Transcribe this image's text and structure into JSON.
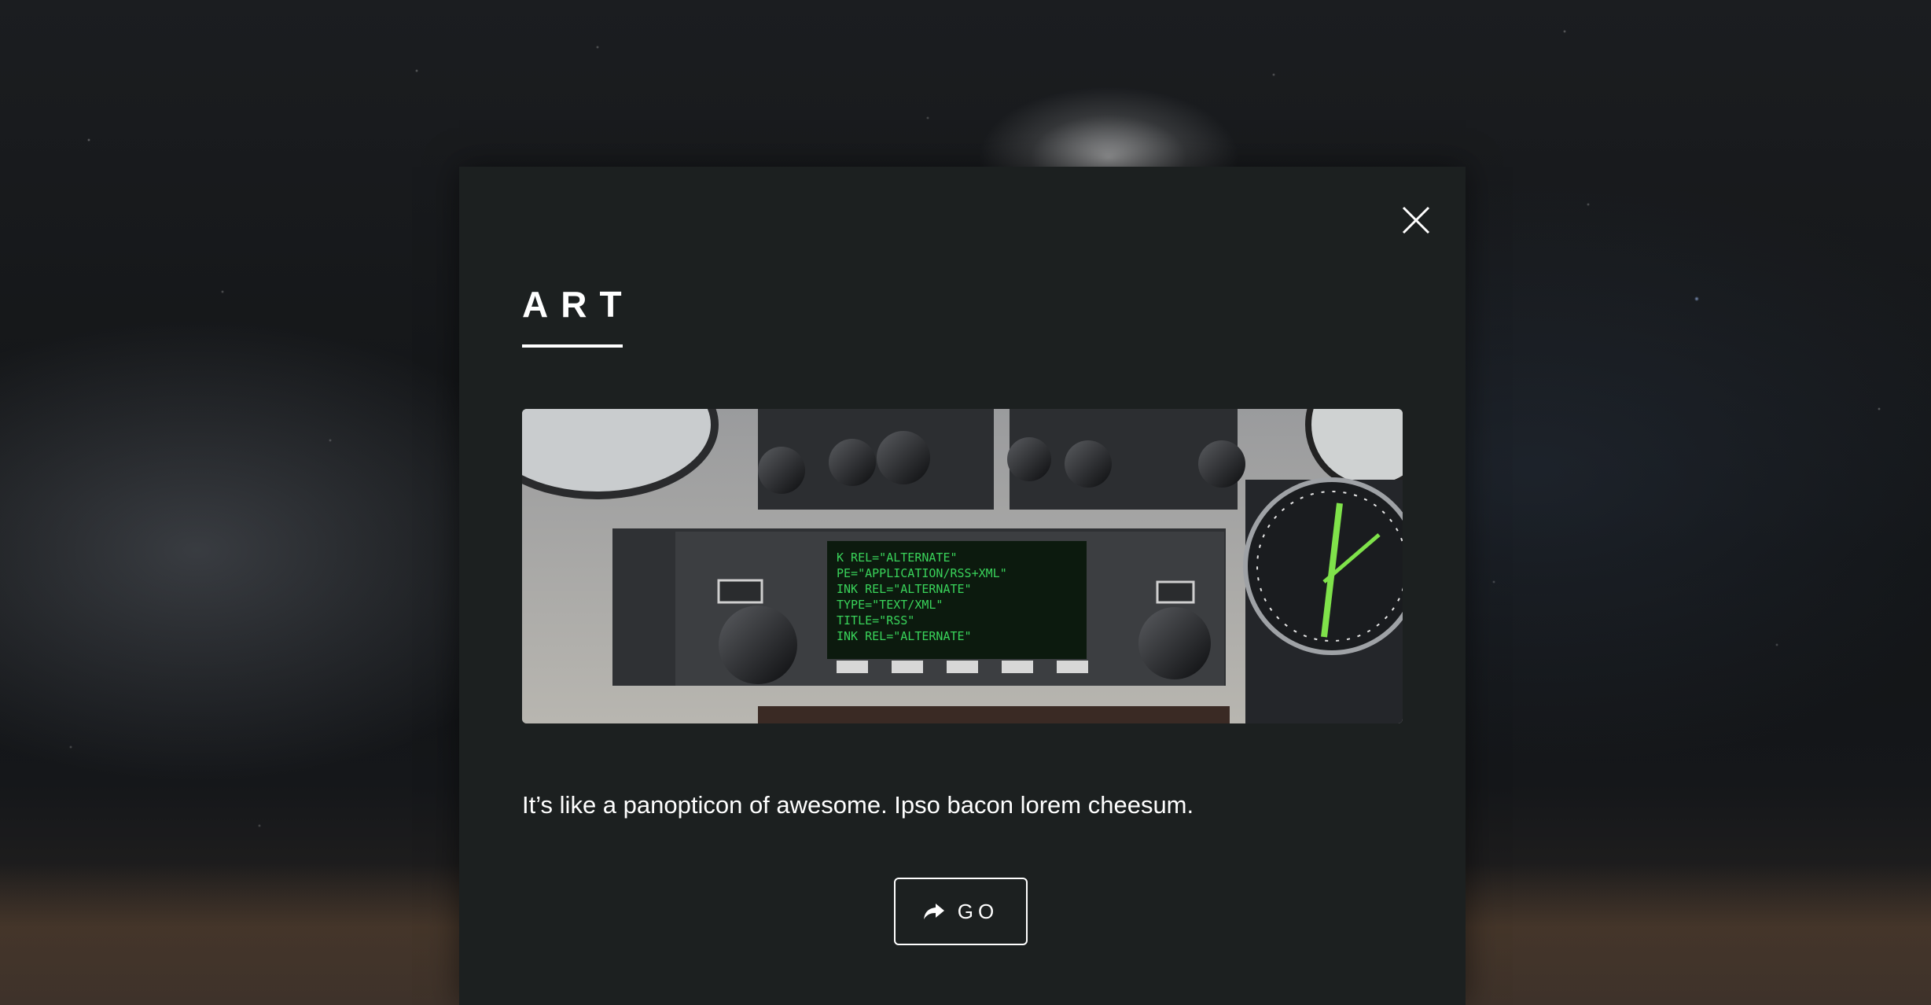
{
  "modal": {
    "title": "ART",
    "image_alt": "Aircraft avionics panel with NAV/COM radios and GPS display",
    "description": "It’s like a panopticon of awesome. Ipso bacon lorem cheesum.",
    "go_button_label": "GO"
  },
  "icons": {
    "close": "close-icon",
    "go": "share-arrow-icon"
  },
  "colors": {
    "modal_background": "#1c2020",
    "text": "#ffffff",
    "button_border": "#ffffff"
  }
}
